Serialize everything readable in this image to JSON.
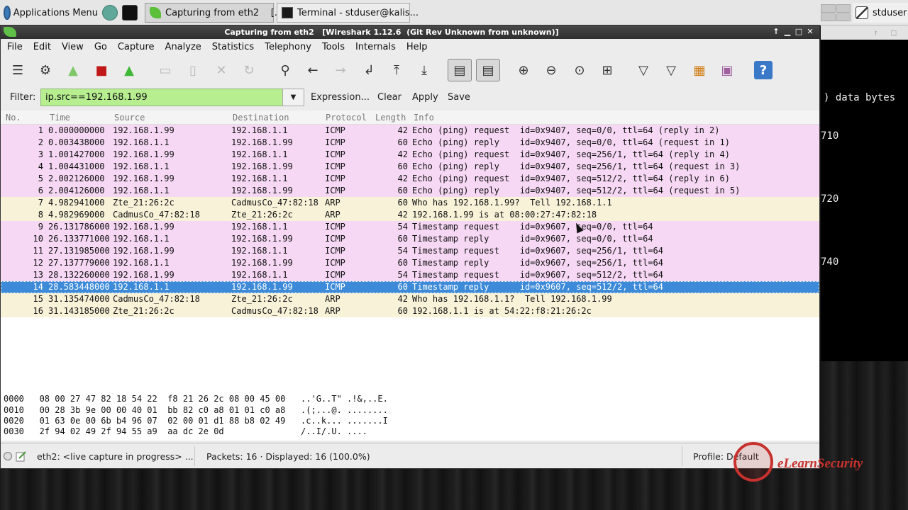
{
  "panel": {
    "apps_menu": "Applications Menu",
    "tasks": [
      {
        "label": "Capturing from eth2    [..."
      },
      {
        "label": "Terminal - stduser@kalis..."
      }
    ],
    "user": "stduser"
  },
  "terminal": {
    "lines": [
      "data bytes",
      "710",
      "720",
      "740"
    ]
  },
  "window": {
    "title": "Capturing from eth2   [Wireshark 1.12.6  (Git Rev Unknown from unknown)]"
  },
  "menu": [
    "File",
    "Edit",
    "View",
    "Go",
    "Capture",
    "Analyze",
    "Statistics",
    "Telephony",
    "Tools",
    "Internals",
    "Help"
  ],
  "filter": {
    "label": "Filter:",
    "value": "ip.src==192.168.1.99",
    "expression": "Expression...",
    "clear": "Clear",
    "apply": "Apply",
    "save": "Save"
  },
  "columns": [
    "No.",
    "Time",
    "Source",
    "Destination",
    "Protocol",
    "Length",
    "Info"
  ],
  "packets": [
    {
      "no": "1",
      "time": "0.000000000",
      "src": "192.168.1.99",
      "dst": "192.168.1.1",
      "proto": "ICMP",
      "len": "42",
      "info": "Echo (ping) request  id=0x9407, seq=0/0, ttl=64 (reply in 2)",
      "type": "icmp"
    },
    {
      "no": "2",
      "time": "0.003438000",
      "src": "192.168.1.1",
      "dst": "192.168.1.99",
      "proto": "ICMP",
      "len": "60",
      "info": "Echo (ping) reply    id=0x9407, seq=0/0, ttl=64 (request in 1)",
      "type": "icmp"
    },
    {
      "no": "3",
      "time": "1.001427000",
      "src": "192.168.1.99",
      "dst": "192.168.1.1",
      "proto": "ICMP",
      "len": "42",
      "info": "Echo (ping) request  id=0x9407, seq=256/1, ttl=64 (reply in 4)",
      "type": "icmp"
    },
    {
      "no": "4",
      "time": "1.004431000",
      "src": "192.168.1.1",
      "dst": "192.168.1.99",
      "proto": "ICMP",
      "len": "60",
      "info": "Echo (ping) reply    id=0x9407, seq=256/1, ttl=64 (request in 3)",
      "type": "icmp"
    },
    {
      "no": "5",
      "time": "2.002126000",
      "src": "192.168.1.99",
      "dst": "192.168.1.1",
      "proto": "ICMP",
      "len": "42",
      "info": "Echo (ping) request  id=0x9407, seq=512/2, ttl=64 (reply in 6)",
      "type": "icmp"
    },
    {
      "no": "6",
      "time": "2.004126000",
      "src": "192.168.1.1",
      "dst": "192.168.1.99",
      "proto": "ICMP",
      "len": "60",
      "info": "Echo (ping) reply    id=0x9407, seq=512/2, ttl=64 (request in 5)",
      "type": "icmp"
    },
    {
      "no": "7",
      "time": "4.982941000",
      "src": "Zte_21:26:2c",
      "dst": "CadmusCo_47:82:18",
      "proto": "ARP",
      "len": "60",
      "info": "Who has 192.168.1.99?  Tell 192.168.1.1",
      "type": "arp"
    },
    {
      "no": "8",
      "time": "4.982969000",
      "src": "CadmusCo_47:82:18",
      "dst": "Zte_21:26:2c",
      "proto": "ARP",
      "len": "42",
      "info": "192.168.1.99 is at 08:00:27:47:82:18",
      "type": "arp"
    },
    {
      "no": "9",
      "time": "26.131786000",
      "src": "192.168.1.99",
      "dst": "192.168.1.1",
      "proto": "ICMP",
      "len": "54",
      "info": "Timestamp request    id=0x9607, seq=0/0, ttl=64",
      "type": "icmp"
    },
    {
      "no": "10",
      "time": "26.133771000",
      "src": "192.168.1.1",
      "dst": "192.168.1.99",
      "proto": "ICMP",
      "len": "60",
      "info": "Timestamp reply      id=0x9607, seq=0/0, ttl=64",
      "type": "icmp"
    },
    {
      "no": "11",
      "time": "27.131985000",
      "src": "192.168.1.99",
      "dst": "192.168.1.1",
      "proto": "ICMP",
      "len": "54",
      "info": "Timestamp request    id=0x9607, seq=256/1, ttl=64",
      "type": "icmp"
    },
    {
      "no": "12",
      "time": "27.137779000",
      "src": "192.168.1.1",
      "dst": "192.168.1.99",
      "proto": "ICMP",
      "len": "60",
      "info": "Timestamp reply      id=0x9607, seq=256/1, ttl=64",
      "type": "icmp"
    },
    {
      "no": "13",
      "time": "28.132260000",
      "src": "192.168.1.99",
      "dst": "192.168.1.1",
      "proto": "ICMP",
      "len": "54",
      "info": "Timestamp request    id=0x9607, seq=512/2, ttl=64",
      "type": "icmp"
    },
    {
      "no": "14",
      "time": "28.583448000",
      "src": "192.168.1.1",
      "dst": "192.168.1.99",
      "proto": "ICMP",
      "len": "60",
      "info": "Timestamp reply      id=0x9607, seq=512/2, ttl=64",
      "type": "sel"
    },
    {
      "no": "15",
      "time": "31.135474000",
      "src": "CadmusCo_47:82:18",
      "dst": "Zte_21:26:2c",
      "proto": "ARP",
      "len": "42",
      "info": "Who has 192.168.1.1?  Tell 192.168.1.99",
      "type": "arp"
    },
    {
      "no": "16",
      "time": "31.143185000",
      "src": "Zte_21:26:2c",
      "dst": "CadmusCo_47:82:18",
      "proto": "ARP",
      "len": "60",
      "info": "192.168.1.1 is at 54:22:f8:21:26:2c",
      "type": "arp"
    }
  ],
  "hex": [
    "0000   08 00 27 47 82 18 54 22  f8 21 26 2c 08 00 45 00   ..'G..T\" .!&,..E.",
    "0010   00 28 3b 9e 00 00 40 01  bb 82 c0 a8 01 01 c0 a8   .(;...@. ........",
    "0020   01 63 0e 00 6b b4 96 07  02 00 01 d1 88 b8 02 49   .c..k... .......I",
    "0030   2f 94 02 49 2f 94 55 a9  aa dc 2e 0d               /..I/.U. ...."
  ],
  "status": {
    "capture": "eth2: <live capture in progress> ...",
    "packets": "Packets: 16 · Displayed: 16 (100.0%)",
    "profile": "Profile: Default"
  },
  "watermark": {
    "text": "eLearnSecurity"
  },
  "colors": {
    "icmp_row": "#f6d8f4",
    "arp_row": "#f8f2d8",
    "selected_row": "#3c8ad8",
    "filter_valid": "#b7ee90"
  }
}
